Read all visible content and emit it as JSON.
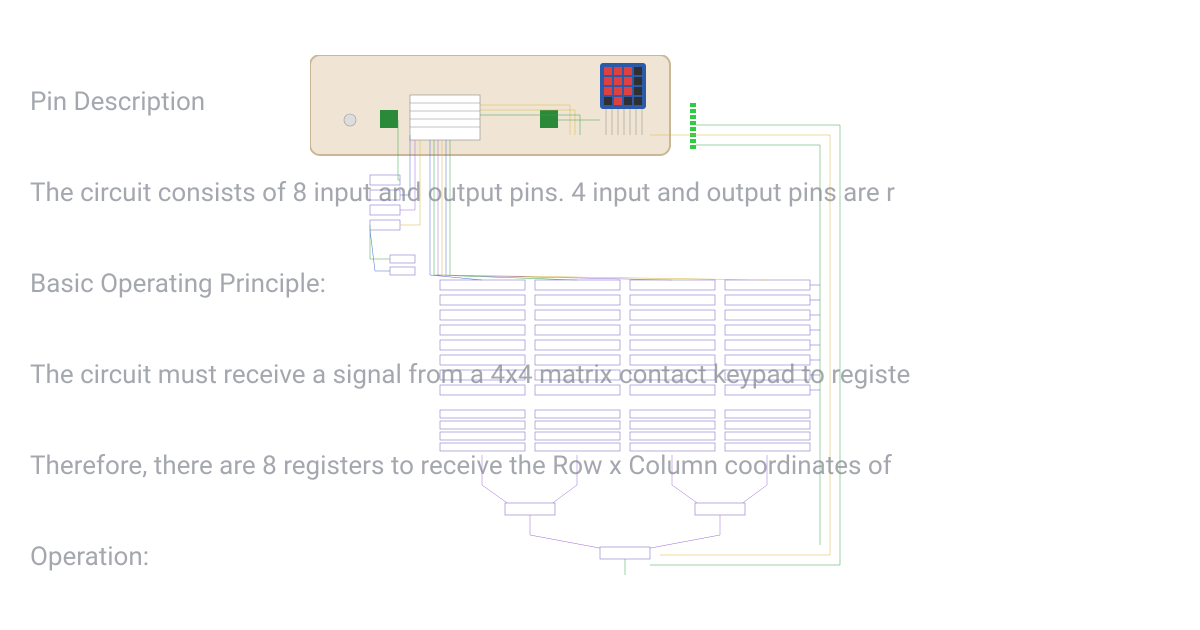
{
  "text": {
    "heading1": "Pin Description",
    "para1": "The circuit consists of 8 input and output pins. 4 input and output pins are r",
    "heading2": "Basic Operating Principle:",
    "para2": "The circuit must receive a signal from a 4x4 matrix contact keypad to registe",
    "para3": "Therefore, there are 8 registers to receive the Row x Column coordinates of ",
    "heading3": "Operation:"
  },
  "diagram": {
    "description": "Electronic circuit schematic with keypad, microcontroller chips, LED array, register banks and wiring",
    "components": {
      "keypad": "4x4 matrix keypad",
      "controller_chip": "microcontroller IC",
      "green_chips": 2,
      "led_bank_count": 8,
      "register_columns": 4,
      "register_rows_per_column": 8
    },
    "colors": {
      "beige": "#f0e5d4",
      "wire_blue": "#4a6ad8",
      "wire_green": "#3aa34a",
      "wire_yellow": "#d8b73a",
      "wire_purple": "#9a6ad8",
      "keypad_blue": "#2b5aa8",
      "keypad_red": "#e04040",
      "led_green": "#2ecc40"
    }
  }
}
